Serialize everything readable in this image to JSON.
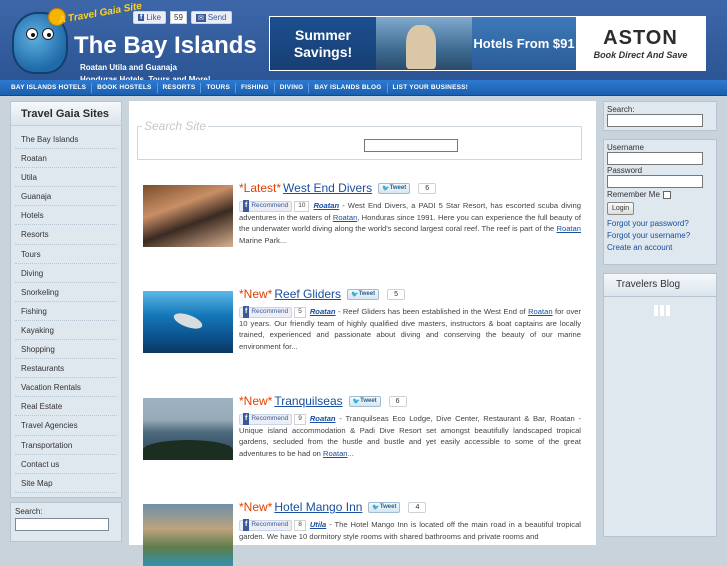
{
  "header": {
    "tagline": "A Travel Gaia Site",
    "title": "The Bay Islands",
    "subtitle_line1": "Roatan Utila and Guanaja",
    "subtitle_line2": "Honduras Hotels, Tours and More!",
    "like_label": "Like",
    "like_count": "59",
    "send_label": "Send",
    "banner": {
      "promo1": "Summer Savings!",
      "promo2": "Hotels From $91",
      "brand": "ASTON",
      "brand_cta": "Book Direct And Save"
    }
  },
  "nav": [
    "BAY ISLANDS HOTELS",
    "BOOK HOSTELS",
    "RESORTS",
    "TOURS",
    "FISHING",
    "DIVING",
    "BAY ISLANDS BLOG",
    "LIST YOUR BUSINESS!"
  ],
  "left_sidebar": {
    "title": "Travel Gaia Sites",
    "items": [
      "The Bay Islands",
      "Roatan",
      "Utila",
      "Guanaja",
      "Hotels",
      "Resorts",
      "Tours",
      "Diving",
      "Snorkeling",
      "Fishing",
      "Kayaking",
      "Shopping",
      "Restaurants",
      "Vacation Rentals",
      "Real Estate",
      "Travel Agencies",
      "Transportation",
      "Contact us",
      "Site Map"
    ],
    "search_label": "Search:"
  },
  "main": {
    "search_legend": "Search Site",
    "articles": [
      {
        "prefix": "*Latest*",
        "title": "West End Divers",
        "tweet_label": "Tweet",
        "tweet_count": "6",
        "rec_label": "Recommend",
        "rec_count": "10",
        "location": "Roatan",
        "body_pre": " - West End Divers, a PADI 5 Star Resort, has escorted scuba diving adventures in the waters of ",
        "body_link": "Roatan",
        "body_mid": ", Honduras since 1991. Here you can experience the full beauty of the underwater world diving along the world's second largest coral reef. The reef is part of the ",
        "body_link2": "Roatan",
        "body_post": " Marine Park..."
      },
      {
        "prefix": "*New*",
        "title": "Reef Gliders",
        "tweet_label": "Tweet",
        "tweet_count": "5",
        "rec_label": "Recommend",
        "rec_count": "5",
        "location": "Roatan",
        "body_pre": " - Reef Gliders has been established in the West End of ",
        "body_link": "Roatan",
        "body_mid": " for over 10 years. Our friendly team of highly qualified dive masters, instructors & boat captains are locally trained, experienced and passionate about diving and conserving the beauty of our marine environment for...",
        "body_link2": "",
        "body_post": ""
      },
      {
        "prefix": "*New*",
        "title": "Tranquilseas",
        "tweet_label": "Tweet",
        "tweet_count": "6",
        "rec_label": "Recommend",
        "rec_count": "9",
        "location": "Roatan",
        "body_pre": " - Tranquilseas Eco Lodge, Dive Center, Restaurant & Bar, Roatan - Unique island accommodation & Padi Dive Resort set amongst beautifully landscaped tropical gardens, secluded from the hustle and bustle and yet easily accessible to some of the great adventures to be had on ",
        "body_link": "Roatan",
        "body_mid": "...",
        "body_link2": "",
        "body_post": ""
      },
      {
        "prefix": "*New*",
        "title": "Hotel Mango Inn",
        "tweet_label": "Tweet",
        "tweet_count": "4",
        "rec_label": "Recommend",
        "rec_count": "8",
        "location": "Utila",
        "body_pre": " - The Hotel Mango Inn is located off the main road in a beautiful tropical garden. We have 10 dormitory style rooms with shared bathrooms and private rooms and",
        "body_link": "",
        "body_mid": "",
        "body_link2": "",
        "body_post": ""
      }
    ]
  },
  "right_sidebar": {
    "search_label": "Search:",
    "username_label": "Username",
    "password_label": "Password",
    "remember_label": "Remember Me",
    "login_label": "Login",
    "forgot_password": "Forgot your password?",
    "forgot_username": "Forgot your username?",
    "create_account": "Create an account",
    "blog_title": "Travelers Blog"
  }
}
